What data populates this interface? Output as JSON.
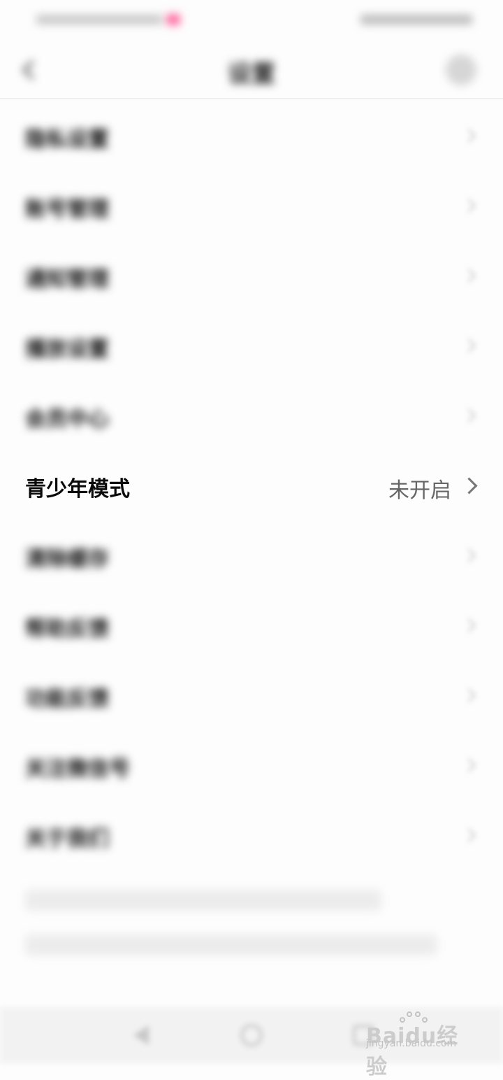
{
  "colors": {
    "accent": "#ff3d8a",
    "background": "#fdfdfd",
    "text_primary": "#111111",
    "text_secondary": "#666666",
    "text_muted": "#a5a5a5"
  },
  "header": {
    "back_icon": "chevron-left-icon",
    "title": "设置",
    "action_icon": "avatar-icon"
  },
  "settings": {
    "items": [
      {
        "label": "隐私设置",
        "value": "",
        "blurred": true
      },
      {
        "label": "账号管理",
        "value": "",
        "blurred": true
      },
      {
        "label": "通知管理",
        "value": "",
        "blurred": true
      },
      {
        "label": "播放设置",
        "value": "",
        "blurred": true
      },
      {
        "label": "会员中心",
        "value": "",
        "blurred": true,
        "accent": true
      },
      {
        "label": "青少年模式",
        "value": "未开启",
        "blurred": false
      },
      {
        "label": "清除缓存",
        "value": "",
        "blurred": true,
        "muted": true
      },
      {
        "label": "帮助反馈",
        "value": "",
        "blurred": true
      },
      {
        "label": "功能反馈",
        "value": "",
        "blurred": true
      },
      {
        "label": "关注微信号",
        "value": "",
        "blurred": true,
        "accent": true
      },
      {
        "label": "关于我们",
        "value": "",
        "blurred": true
      }
    ]
  },
  "contact": {
    "line1": "",
    "line2": ""
  },
  "watermark": {
    "brand": "Baidu经验",
    "url": "jingyan.baidu.com"
  },
  "nav": {
    "back_icon": "triangle-back-icon",
    "home_icon": "circle-home-icon",
    "recent_icon": "square-recent-icon"
  }
}
